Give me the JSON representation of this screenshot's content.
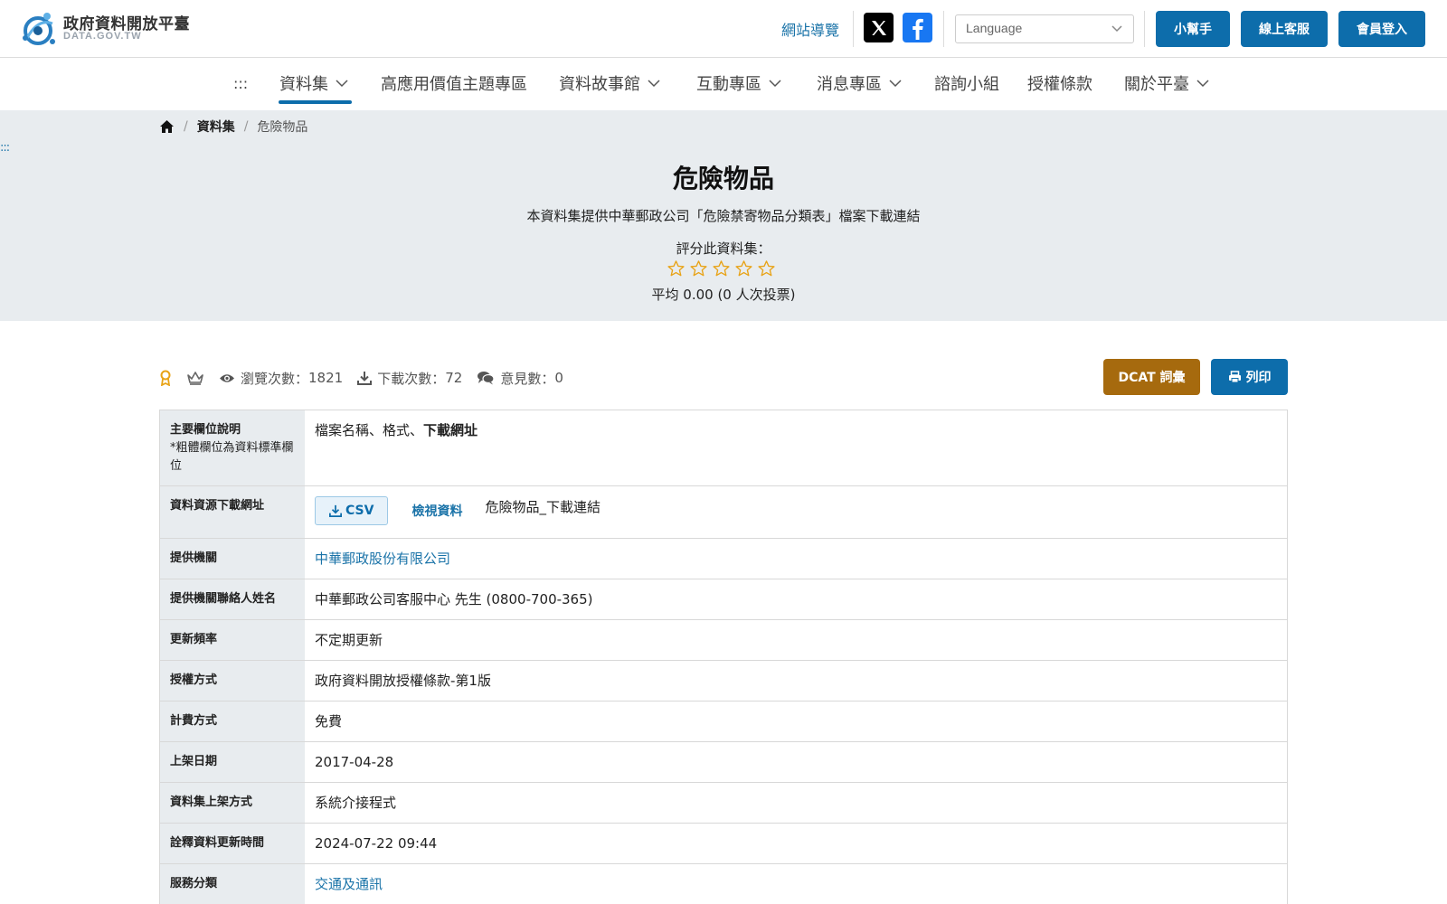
{
  "header": {
    "logo_title": "政府資料開放平臺",
    "logo_sub": "DATA.GOV.TW",
    "sitemap_label": "網站導覽",
    "language_placeholder": "Language",
    "helper_label": "小幫手",
    "service_label": "線上客服",
    "login_label": "會員登入"
  },
  "nav": {
    "accesskey": ":::",
    "items": [
      {
        "label": "資料集",
        "dropdown": true
      },
      {
        "label": "高應用價值主題專區",
        "dropdown": false
      },
      {
        "label": "資料故事館",
        "dropdown": true
      },
      {
        "label": "互動專區",
        "dropdown": true
      },
      {
        "label": "消息專區",
        "dropdown": true
      },
      {
        "label": "諮詢小組",
        "dropdown": false
      },
      {
        "label": "授權條款",
        "dropdown": false
      },
      {
        "label": "關於平臺",
        "dropdown": true
      }
    ]
  },
  "breadcrumb": {
    "home_icon": "home-icon",
    "items": [
      "資料集",
      "危險物品"
    ]
  },
  "hero": {
    "accesskey": ":::",
    "title": "危險物品",
    "description": "本資料集提供中華郵政公司「危險禁寄物品分類表」檔案下載連結",
    "rate_label": "評分此資料集：",
    "star_count": 5,
    "average": "平均 0.00 (0 人次投票)"
  },
  "stats": {
    "views_label": "瀏覽次數：",
    "views": "1821",
    "downloads_label": "下載次數：",
    "downloads": "72",
    "comments_label": "意見數：",
    "comments": "0"
  },
  "buttons": {
    "dcat": "DCAT 詞彙",
    "print": "列印"
  },
  "colors": {
    "primary": "#0d6dab",
    "dcat": "#a66a0e",
    "hero_bg": "#e8ecef",
    "star": "#e8a317"
  },
  "table": {
    "main_fields_label": "主要欄位說明",
    "main_fields_note": "*粗體欄位為資料標準欄位",
    "main_fields_value_plain": "檔案名稱、格式、",
    "main_fields_value_bold": "下載網址",
    "download_label": "資料資源下載網址",
    "csv_label": "CSV",
    "view_label": "檢視資料",
    "resource_name": "危險物品_下載連結",
    "rows": [
      {
        "label": "提供機關",
        "value": "中華郵政股份有限公司",
        "link": true
      },
      {
        "label": "提供機關聯絡人姓名",
        "value": "中華郵政公司客服中心 先生 (0800-700-365)",
        "link": false
      },
      {
        "label": "更新頻率",
        "value": "不定期更新",
        "link": false
      },
      {
        "label": "授權方式",
        "value": "政府資料開放授權條款-第1版",
        "link": false
      },
      {
        "label": "計費方式",
        "value": "免費",
        "link": false
      },
      {
        "label": "上架日期",
        "value": "2017-04-28",
        "link": false
      },
      {
        "label": "資料集上架方式",
        "value": "系統介接程式",
        "link": false
      },
      {
        "label": "詮釋資料更新時間",
        "value": "2024-07-22 09:44",
        "link": false
      },
      {
        "label": "服務分類",
        "value": "交通及通訊",
        "link": true
      }
    ]
  }
}
